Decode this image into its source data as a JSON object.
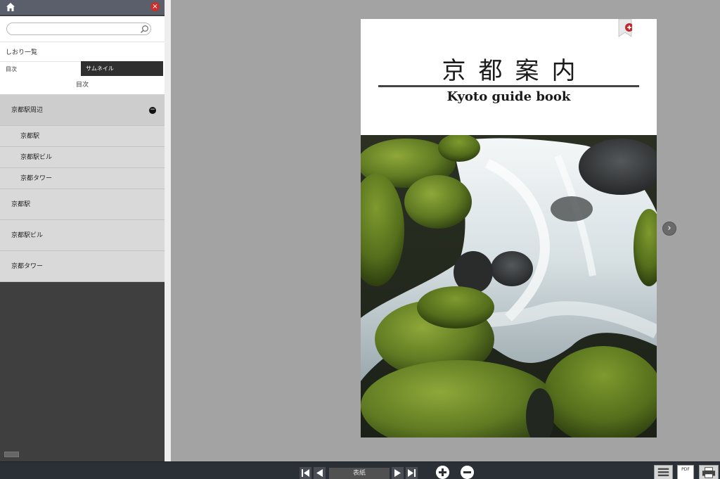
{
  "sidebar": {
    "search": {
      "value": "",
      "placeholder": ""
    },
    "bookmarks_label": "しおり一覧",
    "tabs": [
      {
        "label": "目次",
        "active": false
      },
      {
        "label": "サムネイル",
        "active": true
      }
    ],
    "toc_heading": "目次",
    "toc_items": [
      {
        "label": "京都駅周辺",
        "level": 0,
        "expanded": true
      },
      {
        "label": "京都駅",
        "level": 1
      },
      {
        "label": "京都駅ビル",
        "level": 1
      },
      {
        "label": "京都タワー",
        "level": 1
      },
      {
        "label": "京都駅",
        "level": 0
      },
      {
        "label": "京都駅ビル",
        "level": 0
      },
      {
        "label": "京都タワー",
        "level": 0
      }
    ]
  },
  "page": {
    "title": "京都案内",
    "subtitle": "Kyoto guide book"
  },
  "toolbar": {
    "page_indicator": "表紙",
    "pdf_label": "PDF"
  },
  "colors": {
    "header_bg": "#5a5f6b",
    "close_red": "#c9302c",
    "toolbar_bg": "#2b2f36",
    "viewer_bg": "#a3a3a3"
  },
  "icons": [
    "home-icon",
    "close-icon",
    "search-icon",
    "collapse-icon",
    "bookmark-add-icon",
    "chevron-right-icon",
    "first-page-icon",
    "prev-page-icon",
    "next-icon",
    "last-page-icon",
    "zoom-in-icon",
    "zoom-out-icon",
    "menu-icon",
    "pdf-icon",
    "print-icon"
  ]
}
